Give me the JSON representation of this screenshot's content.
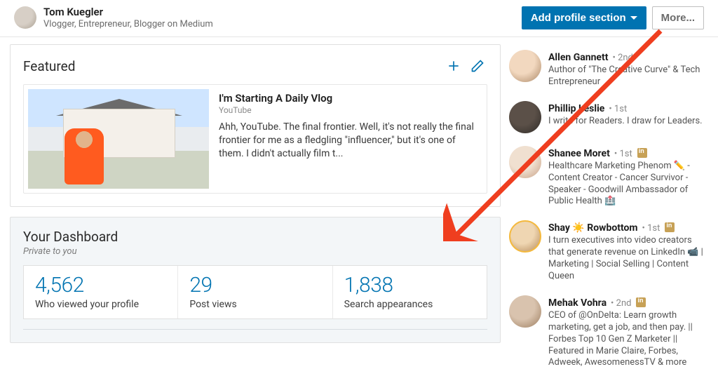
{
  "user": {
    "name": "Tom Kuegler",
    "headline": "Vlogger, Entrepreneur, Blogger on Medium"
  },
  "topbar": {
    "add_section_label": "Add profile section",
    "more_label": "More..."
  },
  "featured": {
    "section_title": "Featured",
    "item": {
      "title": "I'm Starting A Daily Vlog",
      "source": "YouTube",
      "description": "Ahh, YouTube. The final frontier. Well, it's not really the final frontier for me as a fledgling \"influencer,\" but it's one of them. I didn't actually film t..."
    }
  },
  "dashboard": {
    "title": "Your Dashboard",
    "subtitle": "Private to you",
    "stats": [
      {
        "value": "4,562",
        "label": "Who viewed your profile"
      },
      {
        "value": "29",
        "label": "Post views"
      },
      {
        "value": "1,838",
        "label": "Search appearances"
      }
    ]
  },
  "people": [
    {
      "name": "Allen Gannett",
      "meta": "• 2nd",
      "premium": false,
      "desc": "Author of \"The Creative Curve\" & Tech Entrepreneur"
    },
    {
      "name": "Phillip Leslie",
      "meta": "• 1st",
      "premium": false,
      "desc": "I write for Readers. I draw for Leaders."
    },
    {
      "name": "Shanee Moret",
      "meta": "• 1st",
      "premium": true,
      "desc": "Healthcare Marketing Phenom ✏️ - Content Creator - Cancer Survivor - Speaker - Goodwill Ambassador of Public Health 🏥"
    },
    {
      "name": "Shay ☀️ Rowbottom",
      "meta": "• 1st",
      "premium": true,
      "desc": "I turn executives into video creators that generate revenue on LinkedIn 📹 | Marketing | Social Selling | Content Queen"
    },
    {
      "name": "Mehak Vohra",
      "meta": "• 2nd",
      "premium": true,
      "desc": "CEO of @OnDelta: Learn growth marketing, get a job, and then pay. || Forbes Top 10 Gen Z Marketer || Featured in Marie Claire, Forbes, Adweek, AwesomenessTV & more"
    }
  ]
}
